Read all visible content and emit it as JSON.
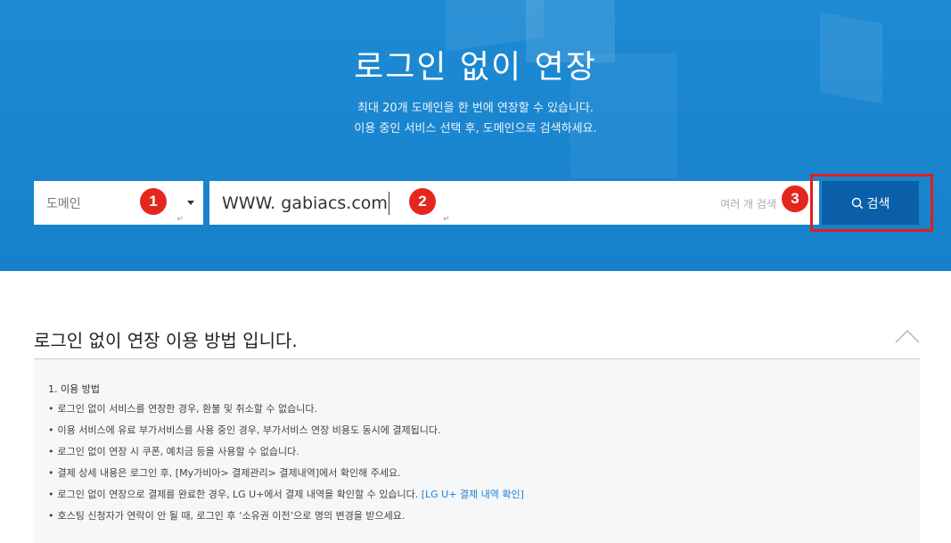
{
  "hero": {
    "title": "로그인 없이 연장",
    "subtitle_line1": "최대 20개 도메인을 한 번에 연장할 수 있습니다.",
    "subtitle_line2": "이용 중인 서비스 선택 후, 도메인으로 검색하세요."
  },
  "search": {
    "select_label": "도메인",
    "input_value": "WWW. gabiacs.com",
    "placeholder_partial": "여러 개 검색",
    "button_label": "검색",
    "return_mark": "↵"
  },
  "badges": [
    "1",
    "2",
    "3"
  ],
  "guide": {
    "section_title": "로그인 없이 연장 이용 방법 입니다.",
    "list_title": "1. 이용 방법",
    "bullet": "•",
    "items": [
      "로그인 없이 서비스를 연장한 경우, 환불 및 취소할 수 없습니다.",
      "이용 서비스에 유료 부가서비스를 사용 중인 경우, 부가서비스 연장 비용도 동시에 결제됩니다.",
      "로그인 없이 연장 시 쿠폰, 예치금 등을 사용할 수 없습니다.",
      "결제 상세 내용은 로그인 후, [My가비아> 결제관리> 결제내역]에서 확인해 주세요.",
      "로그인 없이 연장으로 결제를 완료한 경우, LG U+에서 결제 내역을 확인할 수 있습니다.",
      "호스팅 신청자가 연락이 안 될 때, 로그인 후 ‘소유권 이전’으로 명의 변경을 받으세요."
    ],
    "link_label": "[LG U+ 결제 내역 확인]"
  },
  "colors": {
    "hero_bg": "#1a85cf",
    "button_bg": "#0b5fa8",
    "badge": "#e5261f",
    "highlight": "#e01e1e",
    "link": "#1a7fd6"
  }
}
